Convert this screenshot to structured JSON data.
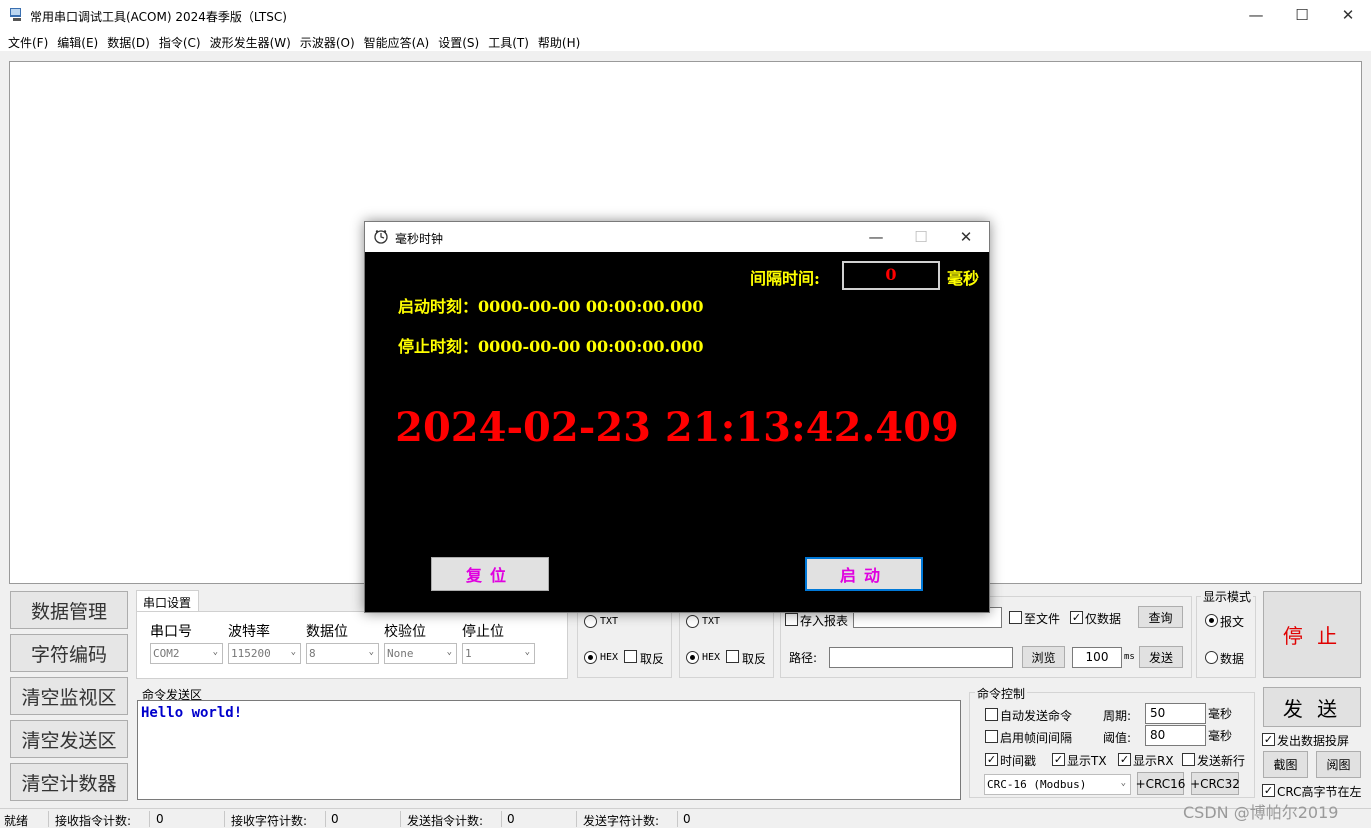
{
  "window": {
    "title": "常用串口调试工具(ACOM) 2024春季版（LTSC)"
  },
  "menu": [
    "文件(F)",
    "编辑(E)",
    "数据(D)",
    "指令(C)",
    "波形发生器(W)",
    "示波器(O)",
    "智能应答(A)",
    "设置(S)",
    "工具(T)",
    "帮助(H)"
  ],
  "left_buttons": [
    "数据管理",
    "字符编码",
    "清空监视区",
    "清空发送区",
    "清空计数器"
  ],
  "serial": {
    "tab": "串口设置",
    "labels": [
      "串口号",
      "波特率",
      "数据位",
      "校验位",
      "停止位"
    ],
    "values": [
      "COM2",
      "115200",
      "8",
      "None",
      "1"
    ]
  },
  "rx_mode": {
    "txt": "TXT",
    "hex": "HEX",
    "invert": "取反",
    "selected": "HEX"
  },
  "tx_mode": {
    "txt": "TXT",
    "hex": "HEX",
    "invert": "取反",
    "selected": "HEX"
  },
  "save": {
    "report": "存入报表",
    "to_file": "至文件",
    "data_only": "仅数据",
    "query": "查询",
    "path_label": "路径:",
    "browse": "浏览",
    "interval": "100",
    "ms": "ms",
    "send": "发送"
  },
  "display_mode": {
    "title": "显示模式",
    "report": "报文",
    "data": "数据"
  },
  "stop_button": "停 止",
  "send_button": "发 送",
  "send_area": {
    "title": "命令发送区",
    "text": "Hello world!"
  },
  "cmd_control": {
    "title": "命令控制",
    "auto_send": "自动发送命令",
    "frame_interval": "启用帧间间隔",
    "period_label": "周期:",
    "period_value": "50",
    "threshold_label": "阈值:",
    "threshold_value": "80",
    "unit": "毫秒",
    "timestamp": "时间戳",
    "show_tx": "显示TX",
    "show_rx": "显示RX",
    "new_line": "发送新行",
    "crc_select": "CRC-16 (Modbus)",
    "crc16": "+CRC16",
    "crc32": "+CRC32"
  },
  "right_panel": {
    "tx_screen": "发出数据投屏",
    "screenshot": "截图",
    "view": "阅图",
    "crc_high": "CRC高字节在左"
  },
  "status": {
    "ready": "就绪",
    "rx_cmd_label": "接收指令计数:",
    "rx_cmd": "0",
    "rx_char_label": "接收字符计数:",
    "rx_char": "0",
    "tx_cmd_label": "发送指令计数:",
    "tx_cmd": "0",
    "tx_char_label": "发送字符计数:",
    "tx_char": "0"
  },
  "watermark": "CSDN @博帕尔2019",
  "dialog": {
    "title": "毫秒时钟",
    "interval_label": "间隔时间:",
    "interval_value": "0",
    "interval_unit": "毫秒",
    "start_time": "启动时刻：0000-00-00 00:00:00.000",
    "stop_time": "停止时刻：0000-00-00 00:00:00.000",
    "clock": "2024-02-23 21:13:42.409",
    "reset": "复位",
    "start": "启动"
  },
  "colors": {
    "clock": "#ff0000",
    "label": "#ffff00",
    "button_text": "#e000e0",
    "stop_text": "#e00000"
  }
}
